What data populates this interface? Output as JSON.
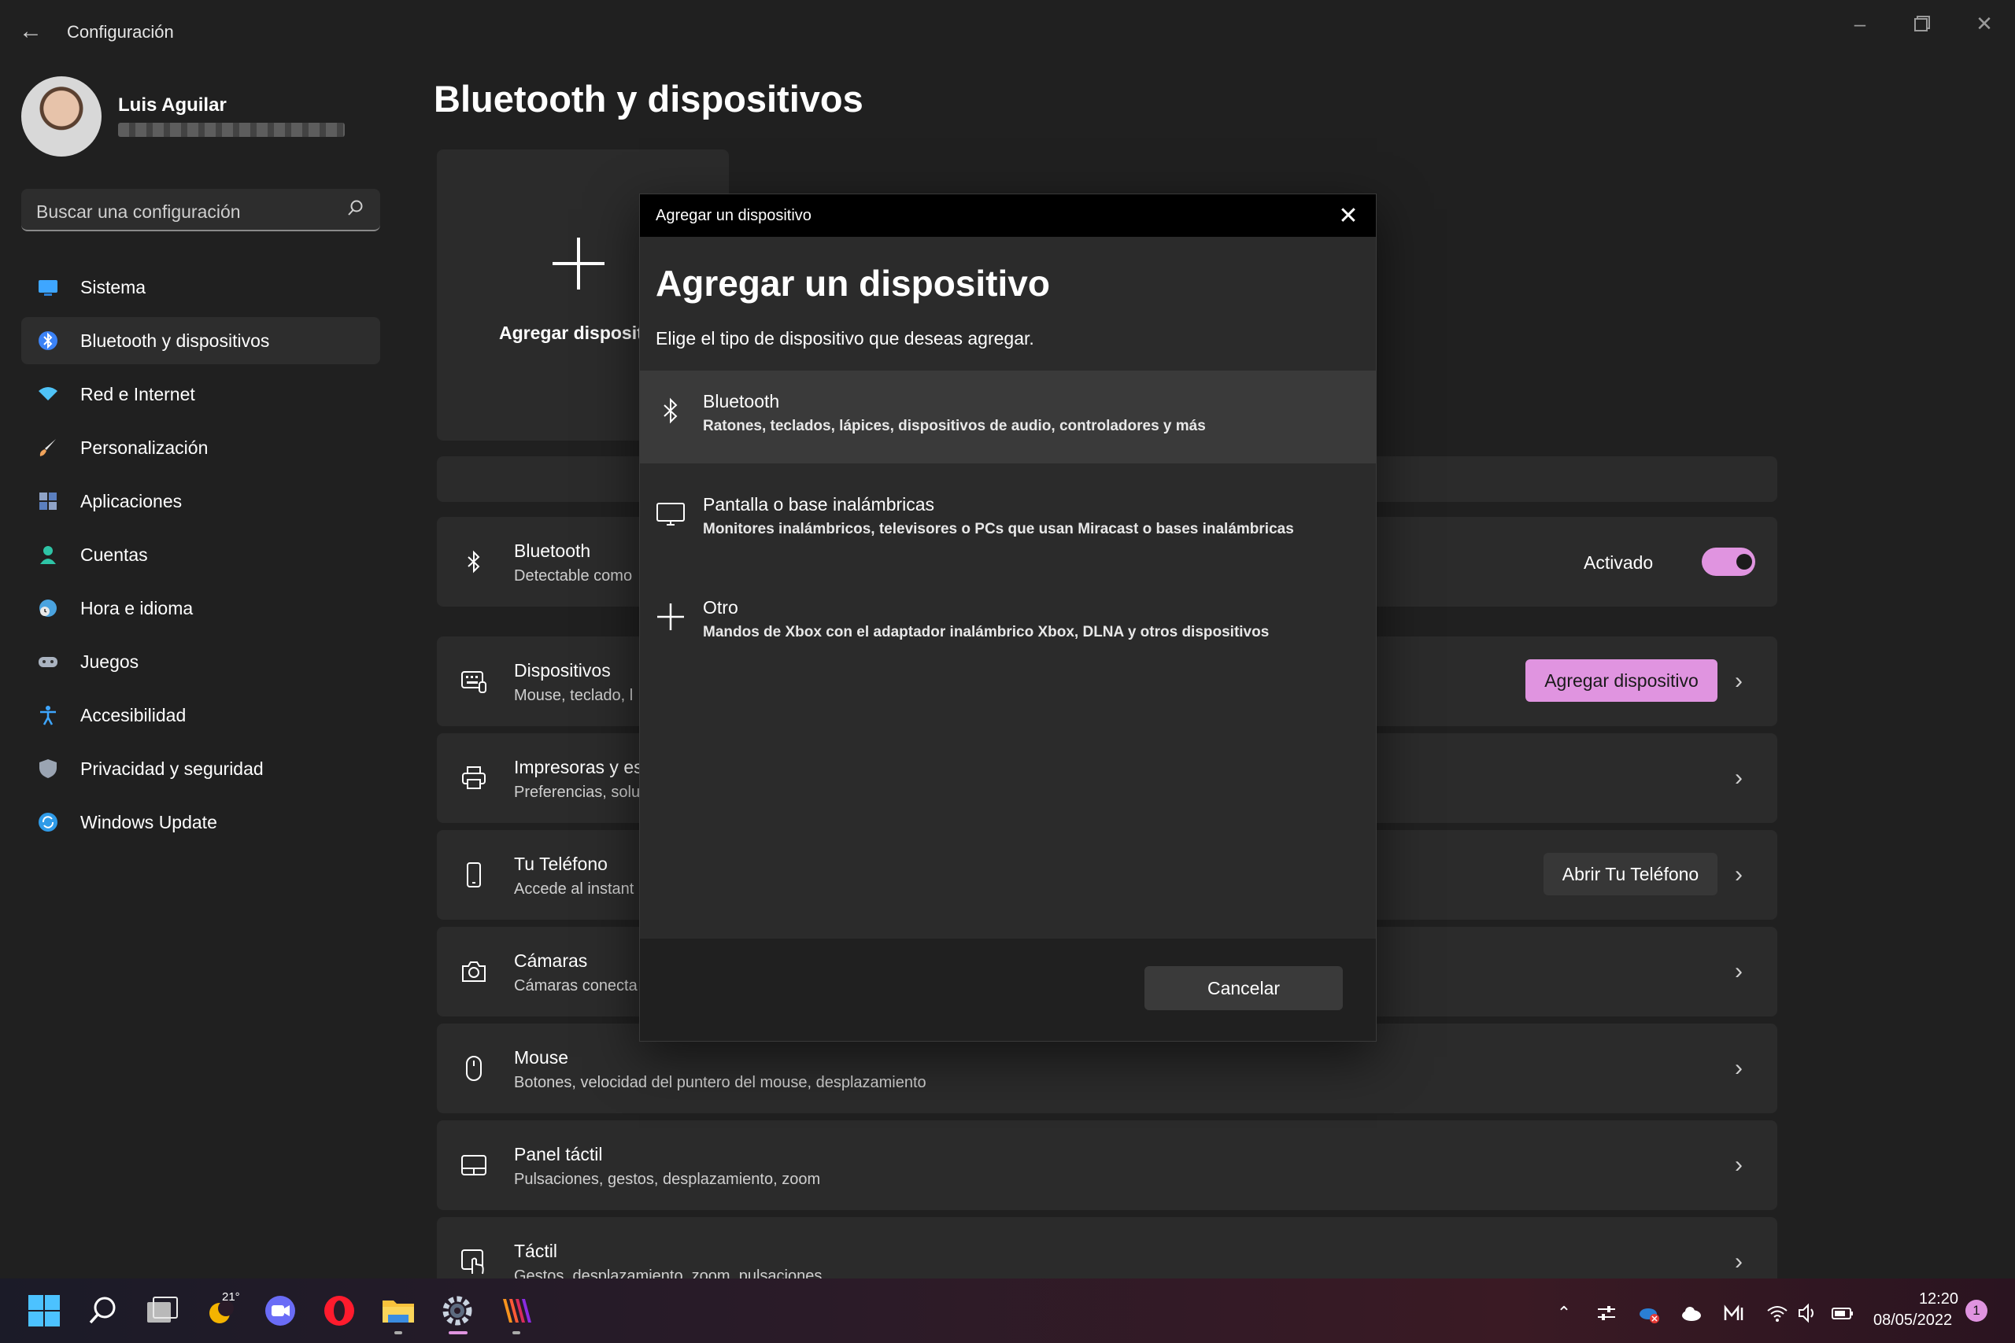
{
  "window": {
    "app_title": "Configuración",
    "back_icon": "arrow-left-icon",
    "controls": [
      "minimize-icon",
      "maximize-icon",
      "close-icon"
    ]
  },
  "user": {
    "name": "Luis Aguilar",
    "email_blurred": true
  },
  "search": {
    "placeholder": "Buscar una configuración"
  },
  "sidebar": {
    "items": [
      {
        "label": "Sistema",
        "icon": "monitor-icon",
        "color": "#3ea6ff"
      },
      {
        "label": "Bluetooth y dispositivos",
        "icon": "bluetooth-icon",
        "color": "#3b82f6",
        "active": true
      },
      {
        "label": "Red e Internet",
        "icon": "wifi-icon",
        "color": "#4fc3f7"
      },
      {
        "label": "Personalización",
        "icon": "brush-icon",
        "color": "#f0a35b"
      },
      {
        "label": "Aplicaciones",
        "icon": "apps-icon",
        "color": "#8fa3c7"
      },
      {
        "label": "Cuentas",
        "icon": "person-icon",
        "color": "#2ec4a6"
      },
      {
        "label": "Hora e idioma",
        "icon": "globe-clock-icon",
        "color": "#4aa3df"
      },
      {
        "label": "Juegos",
        "icon": "gamepad-icon",
        "color": "#aab3c0"
      },
      {
        "label": "Accesibilidad",
        "icon": "accessibility-icon",
        "color": "#3ea6ff"
      },
      {
        "label": "Privacidad y seguridad",
        "icon": "shield-icon",
        "color": "#9aa4b2"
      },
      {
        "label": "Windows Update",
        "icon": "update-icon",
        "color": "#2f9be8"
      }
    ]
  },
  "main": {
    "page_title": "Bluetooth y dispositivos",
    "add_card_label": "Agregar disposit",
    "rows": [
      {
        "title": "Bluetooth",
        "sub": "Detectable como",
        "icon": "bluetooth-icon",
        "toggle_label": "Activado",
        "toggle_on": true
      },
      {
        "title": "Dispositivos",
        "sub": "Mouse, teclado, l",
        "icon": "keyboard-icon",
        "button": "Agregar dispositivo"
      },
      {
        "title": "Impresoras y es",
        "sub": "Preferencias, solu",
        "icon": "printer-icon"
      },
      {
        "title": "Tu Teléfono",
        "sub": "Accede al instant",
        "icon": "phone-icon",
        "button": "Abrir Tu Teléfono"
      },
      {
        "title": "Cámaras",
        "sub": "Cámaras conecta",
        "icon": "camera-icon"
      },
      {
        "title": "Mouse",
        "sub": "Botones, velocidad del puntero del mouse, desplazamiento",
        "icon": "mouse-icon"
      },
      {
        "title": "Panel táctil",
        "sub": "Pulsaciones, gestos, desplazamiento, zoom",
        "icon": "touchpad-icon"
      },
      {
        "title": "Táctil",
        "sub": "Gestos, desplazamiento, zoom, pulsaciones",
        "icon": "touch-icon"
      }
    ]
  },
  "dialog": {
    "titlebar": "Agregar un dispositivo",
    "heading": "Agregar un dispositivo",
    "subtitle": "Elige el tipo de dispositivo que deseas agregar.",
    "options": [
      {
        "title": "Bluetooth",
        "sub": "Ratones, teclados, lápices, dispositivos de audio, controladores y más",
        "icon": "bluetooth-icon",
        "selected": true
      },
      {
        "title": "Pantalla o base inalámbricas",
        "sub": "Monitores inalámbricos, televisores o PCs que usan Miracast o bases inalámbricas",
        "icon": "monitor-icon"
      },
      {
        "title": "Otro",
        "sub": "Mandos de Xbox con el adaptador inalámbrico Xbox, DLNA y otros dispositivos",
        "icon": "plus-icon"
      }
    ],
    "cancel_label": "Cancelar"
  },
  "taskbar": {
    "weather_temp": "21°",
    "time": "12:20",
    "date": "08/05/2022",
    "notification_count": "1",
    "accent": "#e094e0"
  }
}
